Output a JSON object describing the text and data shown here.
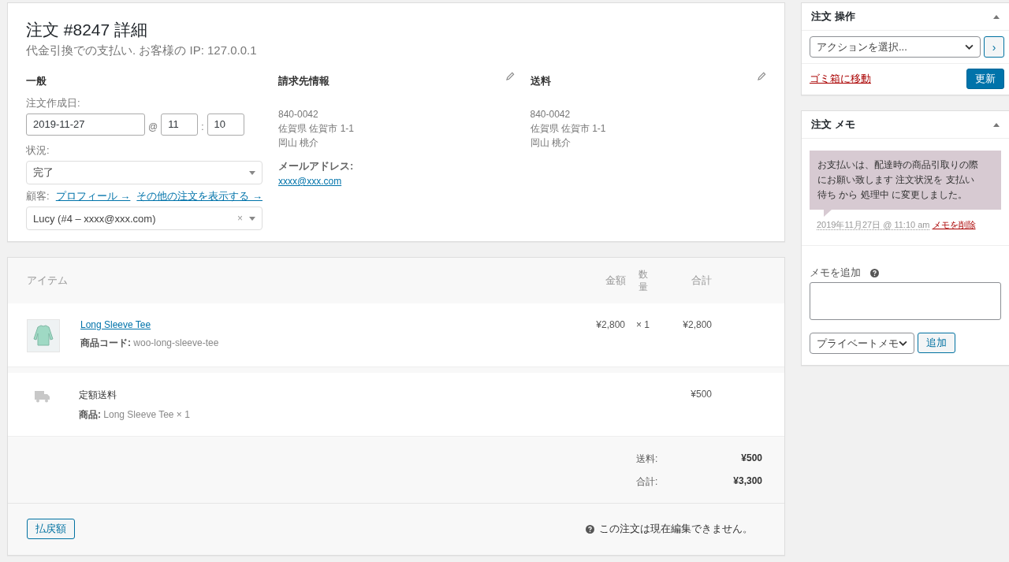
{
  "order": {
    "title": "注文 #8247 詳細",
    "subtitle": "代金引換での支払い. お客様の IP: 127.0.0.1",
    "general": {
      "heading": "一般",
      "date_label": "注文作成日:",
      "date": "2019-11-27",
      "at": "@",
      "hour": "11",
      "colon": ":",
      "minute": "10",
      "status_label": "状況:",
      "status": "完了",
      "customer_label": "顧客:",
      "profile_link": "プロフィール →",
      "other_orders_link": "その他の注文を表示する →",
      "customer": "Lucy (#4 – xxxx@xxx.com)",
      "clear": "×"
    },
    "billing": {
      "heading": "請求先情報",
      "lines": [
        "840-0042",
        "佐賀県 佐賀市 1-1",
        "岡山 桃介"
      ],
      "email_label": "メールアドレス:",
      "email": "xxxx@xxx.com"
    },
    "shipping": {
      "heading": "送料",
      "lines": [
        "840-0042",
        "佐賀県 佐賀市 1-1",
        "岡山 桃介"
      ]
    }
  },
  "items": {
    "columns": [
      "アイテム",
      "金額",
      "数量",
      "合計"
    ],
    "rows": [
      {
        "kind": "product",
        "name": "Long Sleeve Tee",
        "meta_label": "商品コード:",
        "meta": "woo-long-sleeve-tee",
        "cost": "¥2,800",
        "qty": "× 1",
        "total": "¥2,800"
      },
      {
        "kind": "shipping",
        "name": "定額送料",
        "meta_label": "商品:",
        "meta": "Long Sleeve Tee × 1",
        "total": "¥500"
      }
    ],
    "totals": [
      {
        "label": "送料:",
        "value": "¥500"
      },
      {
        "label": "合計:",
        "value": "¥3,300"
      }
    ],
    "refund_button": "払戻額",
    "notice": "この注文は現在編集できません。"
  },
  "actions": {
    "heading": "注文 操作",
    "select": "アクションを選択...",
    "go": "›",
    "trash_link": "ゴミ箱に移動",
    "update_button": "更新"
  },
  "notes": {
    "heading": "注文 メモ",
    "items": [
      {
        "text": "お支払いは、配達時の商品引取りの際にお願い致します 注文状況を 支払い待ち から 処理中 に変更しました。",
        "date": "2019年11月27日 @ 11:10 am",
        "delete_link": "メモを削除"
      }
    ],
    "add_label": "メモを追加",
    "type_select": "プライベートメモ",
    "add_button": "追加"
  }
}
